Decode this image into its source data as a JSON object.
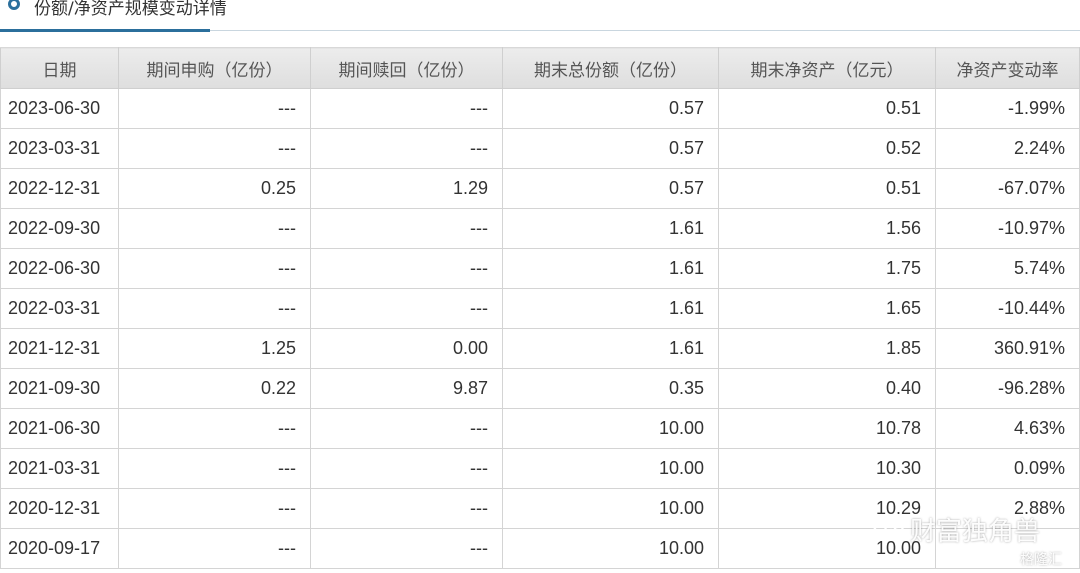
{
  "section": {
    "title": "份额/净资产规模变动详情"
  },
  "table": {
    "headers": [
      "日期",
      "期间申购（亿份）",
      "期间赎回（亿份）",
      "期末总份额（亿份）",
      "期末净资产（亿元）",
      "净资产变动率"
    ],
    "rows": [
      [
        "2023-06-30",
        "---",
        "---",
        "0.57",
        "0.51",
        "-1.99%"
      ],
      [
        "2023-03-31",
        "---",
        "---",
        "0.57",
        "0.52",
        "2.24%"
      ],
      [
        "2022-12-31",
        "0.25",
        "1.29",
        "0.57",
        "0.51",
        "-67.07%"
      ],
      [
        "2022-09-30",
        "---",
        "---",
        "1.61",
        "1.56",
        "-10.97%"
      ],
      [
        "2022-06-30",
        "---",
        "---",
        "1.61",
        "1.75",
        "5.74%"
      ],
      [
        "2022-03-31",
        "---",
        "---",
        "1.61",
        "1.65",
        "-10.44%"
      ],
      [
        "2021-12-31",
        "1.25",
        "0.00",
        "1.61",
        "1.85",
        "360.91%"
      ],
      [
        "2021-09-30",
        "0.22",
        "9.87",
        "0.35",
        "0.40",
        "-96.28%"
      ],
      [
        "2021-06-30",
        "---",
        "---",
        "10.00",
        "10.78",
        "4.63%"
      ],
      [
        "2021-03-31",
        "---",
        "---",
        "10.00",
        "10.30",
        "0.09%"
      ],
      [
        "2020-12-31",
        "---",
        "---",
        "10.00",
        "10.29",
        "2.88%"
      ],
      [
        "2020-09-17",
        "---",
        "---",
        "10.00",
        "10.00",
        ""
      ]
    ]
  },
  "watermark": {
    "line1": "财富独角兽",
    "line2": "格隆汇",
    "icon": "wechat-icon"
  },
  "colors": {
    "accent": "#2b6f9c",
    "header_bg": "#e4e4e4",
    "border": "#d4d4d4",
    "text": "#333333"
  }
}
